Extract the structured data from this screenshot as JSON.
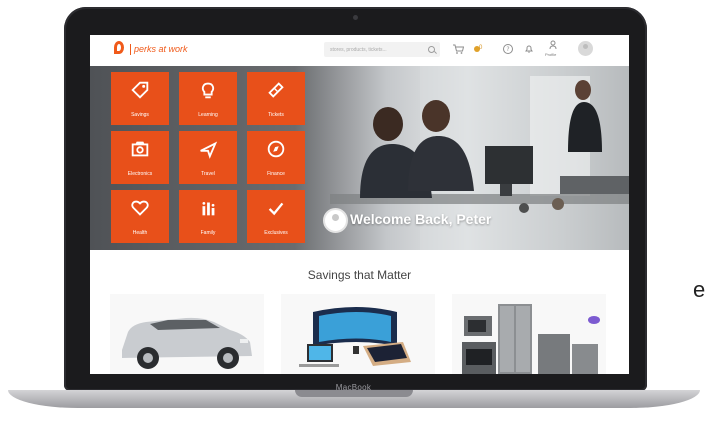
{
  "device": {
    "label": "MacBook",
    "side_text": "e"
  },
  "header": {
    "brand": "perks at work",
    "search_placeholder": "stores, products, tickets...",
    "points": "0",
    "profile_label": "Profile",
    "icons": [
      "search-icon",
      "cart-icon",
      "points-icon",
      "help-icon",
      "notifications-icon",
      "profile-icon",
      "avatar"
    ]
  },
  "hero": {
    "tiles": [
      {
        "label": "Savings",
        "icon": "tag-icon"
      },
      {
        "label": "Learning",
        "icon": "lightbulb-icon"
      },
      {
        "label": "Tickets",
        "icon": "ticket-icon"
      },
      {
        "label": "Electronics",
        "icon": "camera-icon"
      },
      {
        "label": "Travel",
        "icon": "plane-icon"
      },
      {
        "label": "Finance",
        "icon": "compass-icon"
      },
      {
        "label": "Health",
        "icon": "heart-icon"
      },
      {
        "label": "Family",
        "icon": "family-icon"
      },
      {
        "label": "Exclusives",
        "icon": "check-icon"
      }
    ],
    "welcome": "Welcome Back, Peter"
  },
  "savings": {
    "title": "Savings that Matter",
    "cards": [
      {
        "name": "car-card",
        "icon": "car-icon"
      },
      {
        "name": "electronics-card",
        "icon": "devices-icon"
      },
      {
        "name": "appliances-card",
        "icon": "appliances-icon"
      }
    ]
  },
  "colors": {
    "accent": "#f05a1a",
    "tile": "#e8501a",
    "laptop": "#1b1b1d"
  }
}
